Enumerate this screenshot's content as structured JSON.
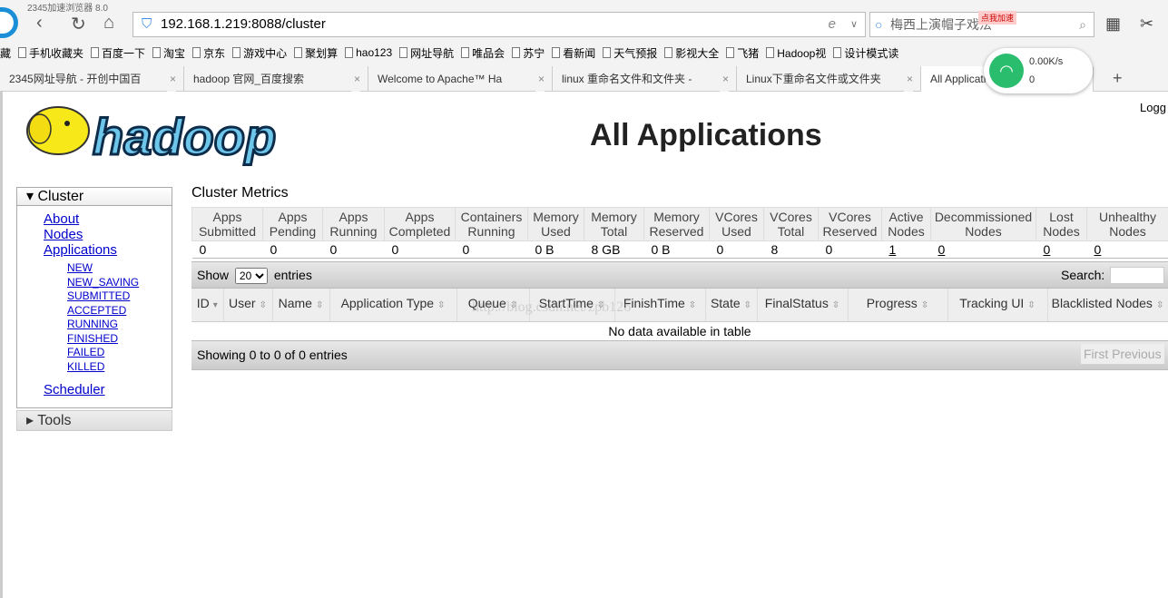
{
  "browser": {
    "top_text": "2345加速浏览器 8.0",
    "url": "192.168.1.219:8088/cluster",
    "search_placeholder": "梅西上演帽子戏法",
    "promo": "点我加速",
    "bookmarks": [
      "藏",
      "手机收藏夹",
      "百度一下",
      "淘宝",
      "京东",
      "游戏中心",
      "聚划算",
      "hao123",
      "网址导航",
      "唯品会",
      "苏宁",
      "看新闻",
      "天气预报",
      "影视大全",
      "飞猪",
      "Hadoop视",
      "设计模式读"
    ],
    "tabs": [
      {
        "label": "2345网址导航 - 开创中国百",
        "active": false
      },
      {
        "label": "hadoop 官网_百度搜索",
        "active": false
      },
      {
        "label": "Welcome to Apache™ Ha",
        "active": false
      },
      {
        "label": "linux 重命名文件和文件夹 -",
        "active": false
      },
      {
        "label": "Linux下重命名文件或文件夹",
        "active": false
      },
      {
        "label": "All Applications",
        "active": true
      }
    ],
    "net_widget": {
      "speed": "0.00K/s",
      "count": "0"
    }
  },
  "page": {
    "login_text": "Logg",
    "title": "All Applications",
    "logo_text": "hadoop",
    "sidebar": {
      "cluster_label": "Cluster",
      "links": [
        "About",
        "Nodes",
        "Applications"
      ],
      "states": [
        "NEW",
        "NEW_SAVING",
        "SUBMITTED",
        "ACCEPTED",
        "RUNNING",
        "FINISHED",
        "FAILED",
        "KILLED"
      ],
      "scheduler": "Scheduler",
      "tools_label": "Tools"
    },
    "metrics": {
      "title": "Cluster Metrics",
      "headers": [
        "Apps Submitted",
        "Apps Pending",
        "Apps Running",
        "Apps Completed",
        "Containers Running",
        "Memory Used",
        "Memory Total",
        "Memory Reserved",
        "VCores Used",
        "VCores Total",
        "VCores Reserved",
        "Active Nodes",
        "Decommissioned Nodes",
        "Lost Nodes",
        "Unhealthy Nodes"
      ],
      "values": [
        "0",
        "0",
        "0",
        "0",
        "0",
        "0 B",
        "8 GB",
        "0 B",
        "0",
        "8",
        "0",
        "1",
        "0",
        "0",
        "0"
      ],
      "links": [
        11,
        12,
        13,
        14
      ]
    },
    "table": {
      "show_label": "Show",
      "show_value": "20",
      "entries_label": "entries",
      "search_label": "Search:",
      "columns": [
        "ID",
        "User",
        "Name",
        "Application Type",
        "Queue",
        "StartTime",
        "FinishTime",
        "State",
        "FinalStatus",
        "Progress",
        "Tracking UI",
        "Blacklisted Nodes"
      ],
      "empty": "No data available in table",
      "info": "Showing 0 to 0 of 0 entries",
      "first": "First",
      "previous": "Previous"
    },
    "watermark": "http://blog.csdn.net/zpb126"
  }
}
